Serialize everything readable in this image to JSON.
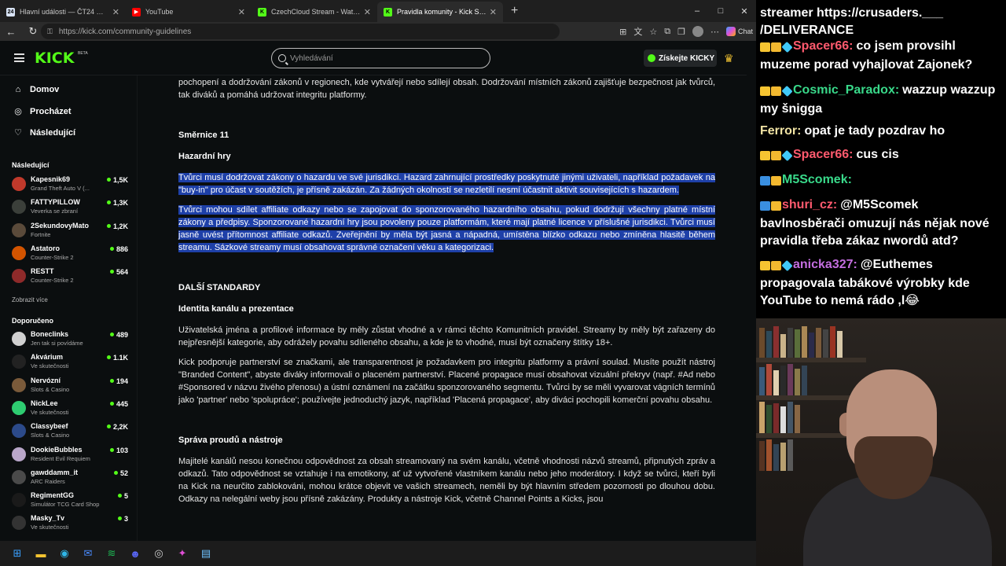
{
  "browser": {
    "tabs": [
      {
        "label": "Hlavní události — ČT24 — Česká televize",
        "fav_color": "#d8e3f5",
        "fav_text": "24"
      },
      {
        "label": "YouTube",
        "fav_color": "#ff0000",
        "fav_text": "▶"
      },
      {
        "label": "CzechCloud Stream - Watch Live on Kick",
        "fav_color": "#53fc18",
        "fav_text": "K"
      },
      {
        "label": "Pravidla komunity - Kick Streaming",
        "fav_color": "#53fc18",
        "fav_text": "K"
      }
    ],
    "new_tab": "+",
    "url": "https://kick.com/community-guidelines",
    "chat_label": "Chat",
    "window_controls": [
      "–",
      "□",
      "✕"
    ]
  },
  "header": {
    "logo": "KICK",
    "beta": "BETA",
    "search_placeholder": "Vyhledávání",
    "kicky_button": "Získejte KICKY"
  },
  "sidebar": {
    "nav": [
      {
        "label": "Domov",
        "icon": "home-icon",
        "glyph": "⌂"
      },
      {
        "label": "Procházet",
        "icon": "compass-icon",
        "glyph": "◎"
      },
      {
        "label": "Následující",
        "icon": "heart-icon",
        "glyph": "♡"
      }
    ],
    "following_header": "Následující",
    "following": [
      {
        "name": "Kapesnik69",
        "category": "Grand Theft Auto V (...",
        "viewers": "1,5K",
        "color": "#c0392b"
      },
      {
        "name": "FATTYPILLOW",
        "category": "Veverka se zbraní",
        "viewers": "1,3K",
        "color": "#3b3f3a"
      },
      {
        "name": "2SekundovyMato",
        "category": "Fortnite",
        "viewers": "1,2K",
        "color": "#5a4a3a"
      },
      {
        "name": "Astatoro",
        "category": "Counter-Strike 2",
        "viewers": "886",
        "color": "#d35400"
      },
      {
        "name": "RESTT",
        "category": "Counter-Strike 2",
        "viewers": "564",
        "color": "#8e2a2a"
      }
    ],
    "show_more": "Zobrazit více",
    "recommended_header": "Doporučeno",
    "recommended": [
      {
        "name": "Boneclinks",
        "category": "Jen tak si povídáme",
        "viewers": "489",
        "color": "#d0d0d0"
      },
      {
        "name": "Akvárium",
        "category": "Ve skutečnosti",
        "viewers": "1.1K",
        "color": "#222"
      },
      {
        "name": "Nervózní",
        "category": "Slots & Casino",
        "viewers": "194",
        "color": "#7a5a3a"
      },
      {
        "name": "NickLee",
        "category": "Ve skutečnosti",
        "viewers": "445",
        "color": "#2ecc71"
      },
      {
        "name": "Classybeef",
        "category": "Slots & Casino",
        "viewers": "2,2K",
        "color": "#2c4a8a"
      },
      {
        "name": "DookieBubbles",
        "category": "Resident Evil Requiem",
        "viewers": "103",
        "color": "#b9a6c9"
      },
      {
        "name": "gawddamm_it",
        "category": "ARC Raiders",
        "viewers": "52",
        "color": "#4a4a4a"
      },
      {
        "name": "RegimentGG",
        "category": "Simulátor TCG Card Shop",
        "viewers": "5",
        "color": "#1a1a1a"
      },
      {
        "name": "Masky_Tv",
        "category": "Ve skutečnosti",
        "viewers": "3",
        "color": "#333"
      }
    ]
  },
  "article": {
    "intro": "včetně podsvětlení nebo obrazů. Užívatel musí spolupracovat s úřady např jurisdikcí, když je to nutné, a uživatelé jsou odpovědní za pochopení a dodržování zákonů v regionech, kde vytvářejí nebo sdílejí obsah. Dodržování místních zákonů zajišťuje bezpečnost jak tvůrců, tak diváků a pomáhá udržovat integritu platformy.",
    "guideline_number": "Směrnice 11",
    "guideline_title": "Hazardní hry",
    "para1": "Tvůrci musí dodržovat zákony o hazardu ve své jurisdikci. Hazard zahrnující prostředky poskytnuté jinými uživateli, například požadavek na \"buy-in\" pro účast v soutěžích, je přísně zakázán. Za žádných okolností se nezletilí nesmí účastnit aktivit souvisejících s hazardem.",
    "para2": "Tvůrci mohou sdílet affiliate odkazy nebo se zapojovat do sponzorovaného hazardního obsahu, pokud dodržují všechny platné místní zákony a předpisy. Sponzorované hazardní hry jsou povoleny pouze platformám, které mají platné licence v příslušné jurisdikci. Tvůrci musí jasně uvést přítomnost affiliate odkazů. Zveřejnění by měla být jasná a nápadná, umístěna blízko odkazu nebo zmíněna hlasitě během streamu. Sázkové streamy musí obsahovat správné označení věku a kategorizaci.",
    "section_title": "DALŠÍ STANDARDY",
    "sub1": "Identita kanálu a prezentace",
    "para3": "Uživatelská jména a profilové informace by měly zůstat vhodné a v rámci těchto Komunitních pravidel. Streamy by měly být zařazeny do nejpřesnější kategorie, aby odrážely povahu sdíleného obsahu, a kde je to vhodné, musí být označeny štítky 18+.",
    "para4": "Kick podporuje partnerství se značkami, ale transparentnost je požadavkem pro integritu platformy a právní soulad. Musíte použít nástroj \"Branded Content\", abyste diváky informovali o placeném partnerství. Placené propagace musí obsahovat vizuální překryv (např. #Ad nebo #Sponsored v názvu živého přenosu) a ústní oznámení na začátku sponzorovaného segmentu. Tvůrci by se měli vyvarovat vágních termínů jako 'partner' nebo 'spolupráce'; používejte jednoduchý jazyk, například 'Placená propagace', aby diváci pochopili komerční povahu obsahu.",
    "sub2": "Správa proudů a nástroje",
    "para5": "Majitelé kanálů nesou konečnou odpovědnost za obsah streamovaný na svém kanálu, včetně vhodnosti názvů streamů, připnutých zpráv a odkazů. Tato odpovědnost se vztahuje i na emotikony, ať už vytvořené vlastníkem kanálu nebo jeho moderátory. I když se tvůrci, kteří byli na Kick na neurčito zablokováni, mohou krátce objevit ve vašich streamech, neměli by být hlavním středem pozornosti po dlouhou dobu. Odkazy na nelegální weby jsou přísně zakázány. Produkty a nástroje Kick, včetně Channel Points a Kicks, jsou"
  },
  "chat": {
    "messages": [
      {
        "badges": [],
        "user": "",
        "user_color": "#ffffff",
        "text": "streamer https://crusaders.___ /DELIVERANCE"
      },
      {
        "badges": [
          "crown",
          "hand",
          "gem"
        ],
        "user": "Spacer66:",
        "user_color": "#ff5a6e",
        "text": "co jsem provsihl muzeme porad vyhajlovat Zajonek?"
      },
      {
        "badges": [
          "crown",
          "hand",
          "gem"
        ],
        "user": "Cosmic_Paradox:",
        "user_color": "#39d98a",
        "text": "wazzup wazzup my šnigga"
      },
      {
        "badges": [],
        "user": "Ferror:",
        "user_color": "#f1e3a4",
        "text": "opat je tady pozdrav ho"
      },
      {
        "badges": [
          "crown",
          "hand",
          "gem"
        ],
        "user": "Spacer66:",
        "user_color": "#ff5a6e",
        "text": "cus cis"
      },
      {
        "badges": [
          "arrow",
          "hand"
        ],
        "user": "M5Scomek:",
        "user_color": "#39d98a",
        "text": ""
      },
      {
        "badges": [
          "arrow",
          "hand"
        ],
        "user": "shuri_cz:",
        "user_color": "#ff5a6e",
        "text": "@M5Scomek bavlnosběrači omuzují nás nějak nové pravidla třeba zákaz nwordů atd?"
      },
      {
        "badges": [
          "crown",
          "hand",
          "gem"
        ],
        "user": "anicka327:",
        "user_color": "#c46ee0",
        "text": "@Euthemes propagovala tabákové výrobky kde YouTube to nemá rádo ,l😂"
      }
    ]
  },
  "taskbar": {
    "icons": [
      {
        "name": "windows-start-icon",
        "glyph": "⊞",
        "color": "#3aa0ff"
      },
      {
        "name": "file-explorer-icon",
        "glyph": "▬",
        "color": "#f6c431"
      },
      {
        "name": "edge-browser-icon",
        "glyph": "◉",
        "color": "#2fb6e8"
      },
      {
        "name": "messenger-icon",
        "glyph": "✉",
        "color": "#4a8cff"
      },
      {
        "name": "spotify-icon",
        "glyph": "≋",
        "color": "#1db954"
      },
      {
        "name": "discord-icon",
        "glyph": "☻",
        "color": "#5865f2"
      },
      {
        "name": "obs-icon",
        "glyph": "◎",
        "color": "#cccccc"
      },
      {
        "name": "copilot-icon",
        "glyph": "✦",
        "color": "#e04fd6"
      },
      {
        "name": "notepad-icon",
        "glyph": "▤",
        "color": "#6fc3ff"
      }
    ]
  }
}
